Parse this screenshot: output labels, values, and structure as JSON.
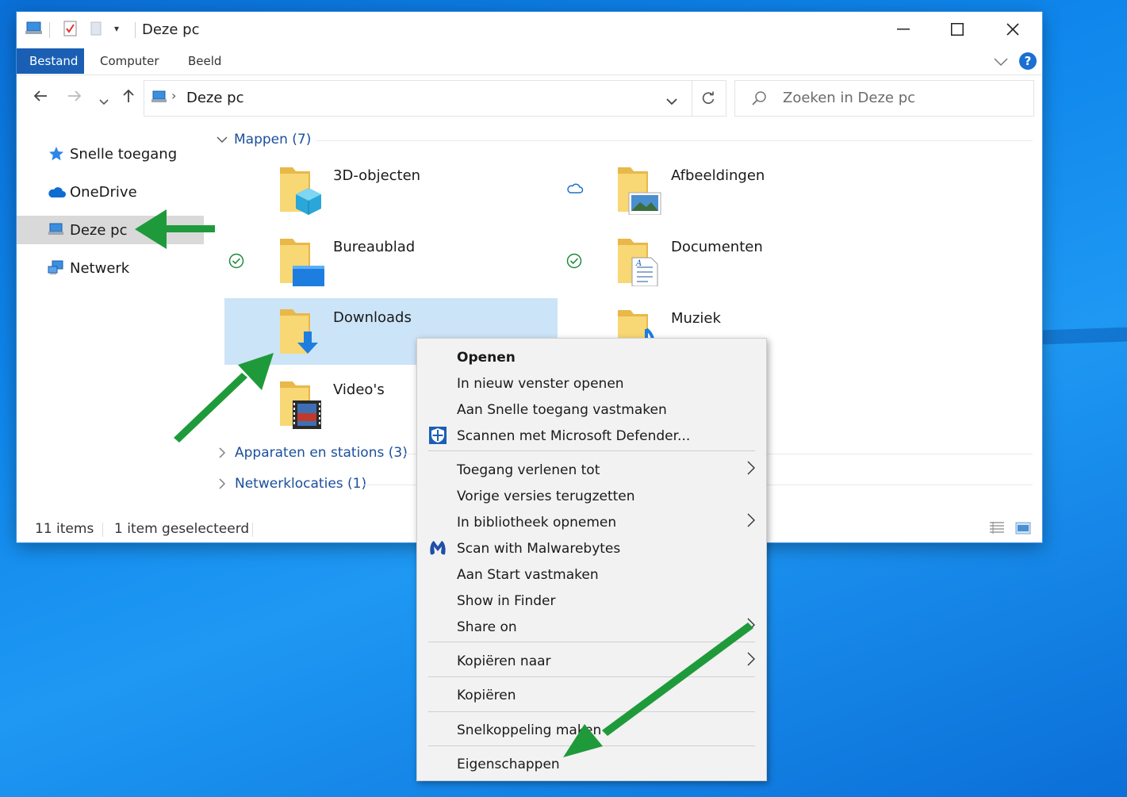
{
  "window": {
    "title": "Deze pc"
  },
  "ribbon": {
    "tabs": [
      {
        "label": "Bestand"
      },
      {
        "label": "Computer"
      },
      {
        "label": "Beeld"
      }
    ]
  },
  "address": {
    "path": "Deze pc",
    "search_placeholder": "Zoeken in Deze pc"
  },
  "sidebar": {
    "items": [
      {
        "label": "Snelle toegang",
        "icon": "star-icon"
      },
      {
        "label": "OneDrive",
        "icon": "cloud-icon"
      },
      {
        "label": "Deze pc",
        "icon": "computer-icon",
        "selected": true
      },
      {
        "label": "Netwerk",
        "icon": "network-icon"
      }
    ]
  },
  "content": {
    "groups": [
      {
        "label": "Mappen (7)",
        "expanded": true
      },
      {
        "label": "Apparaten en stations (3)",
        "expanded": false
      },
      {
        "label": "Netwerklocaties (1)",
        "expanded": false
      }
    ],
    "folders": [
      {
        "name": "3D-objecten",
        "icon": "3d-objects-folder-icon"
      },
      {
        "name": "Afbeeldingen",
        "icon": "pictures-folder-icon",
        "status": "cloud"
      },
      {
        "name": "Bureaublad",
        "icon": "desktop-folder-icon",
        "status": "synced"
      },
      {
        "name": "Documenten",
        "icon": "documents-folder-icon",
        "status": "synced"
      },
      {
        "name": "Downloads",
        "icon": "downloads-folder-icon",
        "selected": true
      },
      {
        "name": "Muziek",
        "icon": "music-folder-icon"
      },
      {
        "name": "Video's",
        "icon": "videos-folder-icon"
      }
    ]
  },
  "statusbar": {
    "count": "11 items",
    "selection": "1 item geselecteerd"
  },
  "context_menu": {
    "items": [
      {
        "label": "Openen",
        "bold": true
      },
      {
        "label": "In nieuw venster openen"
      },
      {
        "label": "Aan Snelle toegang vastmaken"
      },
      {
        "label": "Scannen met Microsoft Defender...",
        "icon": "defender-shield-icon"
      },
      {
        "label": "Toegang verlenen tot",
        "submenu": true
      },
      {
        "label": "Vorige versies terugzetten"
      },
      {
        "label": "In bibliotheek opnemen",
        "submenu": true
      },
      {
        "label": "Scan with Malwarebytes",
        "icon": "malwarebytes-icon"
      },
      {
        "label": "Aan Start vastmaken"
      },
      {
        "label": "Show in Finder"
      },
      {
        "label": "Share on",
        "submenu": true
      },
      {
        "label": "Kopiëren naar",
        "submenu": true
      },
      {
        "label": "Kopiëren"
      },
      {
        "label": "Snelkoppeling maken"
      },
      {
        "label": "Eigenschappen"
      }
    ]
  },
  "colors": {
    "accent": "#1a5fb4",
    "selection": "#cce4f7",
    "annotation_arrow": "#1f9a3b"
  }
}
